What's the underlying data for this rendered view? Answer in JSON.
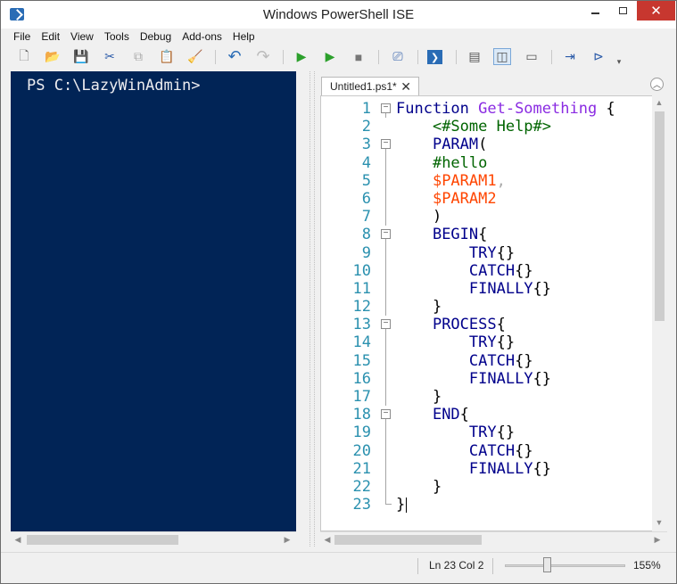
{
  "window": {
    "title": "Windows PowerShell ISE"
  },
  "menu": [
    "File",
    "Edit",
    "View",
    "Tools",
    "Debug",
    "Add-ons",
    "Help"
  ],
  "toolbar": [
    {
      "name": "new-icon",
      "glyph": "🗋"
    },
    {
      "name": "open-icon",
      "glyph": "📂"
    },
    {
      "name": "save-icon",
      "glyph": "💾"
    },
    {
      "name": "cut-icon",
      "glyph": "✂"
    },
    {
      "name": "copy-icon",
      "glyph": "⧉"
    },
    {
      "name": "paste-icon",
      "glyph": "📋"
    },
    {
      "name": "clear-console-icon",
      "glyph": "🧹"
    },
    {
      "name": "undo-icon",
      "glyph": "↶"
    },
    {
      "name": "redo-icon",
      "glyph": "↷"
    },
    {
      "name": "run-script-icon",
      "glyph": "▶"
    },
    {
      "name": "run-selection-icon",
      "glyph": "▶"
    },
    {
      "name": "stop-icon",
      "glyph": "■"
    },
    {
      "name": "remote-tab-icon",
      "glyph": "⎚"
    },
    {
      "name": "powershell-console-icon",
      "glyph": "❯"
    },
    {
      "name": "layout-top-icon",
      "glyph": "▤"
    },
    {
      "name": "layout-right-icon",
      "glyph": "◫"
    },
    {
      "name": "layout-max-icon",
      "glyph": "▭"
    },
    {
      "name": "show-script-pane-icon",
      "glyph": "⇥"
    },
    {
      "name": "show-commands-icon",
      "glyph": "⊳"
    }
  ],
  "console": {
    "prompt": "PS C:\\LazyWinAdmin>"
  },
  "editor": {
    "tab_label": "Untitled1.ps1*",
    "tab_close": "✕",
    "line_numbers": [
      "1",
      "2",
      "3",
      "4",
      "5",
      "6",
      "7",
      "8",
      "9",
      "10",
      "11",
      "12",
      "13",
      "14",
      "15",
      "16",
      "17",
      "18",
      "19",
      "20",
      "21",
      "22",
      "23"
    ],
    "lines": [
      [
        {
          "t": "Function ",
          "c": "kw"
        },
        {
          "t": "Get-Something",
          "c": "cmd"
        },
        {
          "t": " {",
          "c": "grp"
        }
      ],
      [
        {
          "t": "    ",
          "c": "grp"
        },
        {
          "t": "<#Some Help#>",
          "c": "cmt"
        }
      ],
      [
        {
          "t": "    ",
          "c": "grp"
        },
        {
          "t": "PARAM",
          "c": "kw"
        },
        {
          "t": "(",
          "c": "grp"
        }
      ],
      [
        {
          "t": "    ",
          "c": "grp"
        },
        {
          "t": "#hello",
          "c": "cmt"
        }
      ],
      [
        {
          "t": "    ",
          "c": "grp"
        },
        {
          "t": "$PARAM1",
          "c": "var"
        },
        {
          "t": ",",
          "c": "op"
        }
      ],
      [
        {
          "t": "    ",
          "c": "grp"
        },
        {
          "t": "$PARAM2",
          "c": "var"
        }
      ],
      [
        {
          "t": "    ",
          "c": "grp"
        },
        {
          "t": ")",
          "c": "grp"
        }
      ],
      [
        {
          "t": "    ",
          "c": "grp"
        },
        {
          "t": "BEGIN",
          "c": "kw"
        },
        {
          "t": "{",
          "c": "grp"
        }
      ],
      [
        {
          "t": "        ",
          "c": "grp"
        },
        {
          "t": "TRY",
          "c": "kw"
        },
        {
          "t": "{}",
          "c": "grp"
        }
      ],
      [
        {
          "t": "        ",
          "c": "grp"
        },
        {
          "t": "CATCH",
          "c": "kw"
        },
        {
          "t": "{}",
          "c": "grp"
        }
      ],
      [
        {
          "t": "        ",
          "c": "grp"
        },
        {
          "t": "FINALLY",
          "c": "kw"
        },
        {
          "t": "{}",
          "c": "grp"
        }
      ],
      [
        {
          "t": "    ",
          "c": "grp"
        },
        {
          "t": "}",
          "c": "grp"
        }
      ],
      [
        {
          "t": "    ",
          "c": "grp"
        },
        {
          "t": "PROCESS",
          "c": "kw"
        },
        {
          "t": "{",
          "c": "grp"
        }
      ],
      [
        {
          "t": "        ",
          "c": "grp"
        },
        {
          "t": "TRY",
          "c": "kw"
        },
        {
          "t": "{}",
          "c": "grp"
        }
      ],
      [
        {
          "t": "        ",
          "c": "grp"
        },
        {
          "t": "CATCH",
          "c": "kw"
        },
        {
          "t": "{}",
          "c": "grp"
        }
      ],
      [
        {
          "t": "        ",
          "c": "grp"
        },
        {
          "t": "FINALLY",
          "c": "kw"
        },
        {
          "t": "{}",
          "c": "grp"
        }
      ],
      [
        {
          "t": "    ",
          "c": "grp"
        },
        {
          "t": "}",
          "c": "grp"
        }
      ],
      [
        {
          "t": "    ",
          "c": "grp"
        },
        {
          "t": "END",
          "c": "kw"
        },
        {
          "t": "{",
          "c": "grp"
        }
      ],
      [
        {
          "t": "        ",
          "c": "grp"
        },
        {
          "t": "TRY",
          "c": "kw"
        },
        {
          "t": "{}",
          "c": "grp"
        }
      ],
      [
        {
          "t": "        ",
          "c": "grp"
        },
        {
          "t": "CATCH",
          "c": "kw"
        },
        {
          "t": "{}",
          "c": "grp"
        }
      ],
      [
        {
          "t": "        ",
          "c": "grp"
        },
        {
          "t": "FINALLY",
          "c": "kw"
        },
        {
          "t": "{}",
          "c": "grp"
        }
      ],
      [
        {
          "t": "    ",
          "c": "grp"
        },
        {
          "t": "}",
          "c": "grp"
        }
      ],
      [
        {
          "t": "}",
          "c": "grp"
        }
      ]
    ],
    "folds": [
      "open",
      "",
      "open",
      "line",
      "line",
      "line",
      "line",
      "open",
      "line",
      "line",
      "line",
      "line",
      "open",
      "line",
      "line",
      "line",
      "line",
      "open",
      "line",
      "line",
      "line",
      "line",
      "end"
    ]
  },
  "status": {
    "position": "Ln 23  Col 2",
    "zoom": "155%",
    "zoom_value": 155
  }
}
